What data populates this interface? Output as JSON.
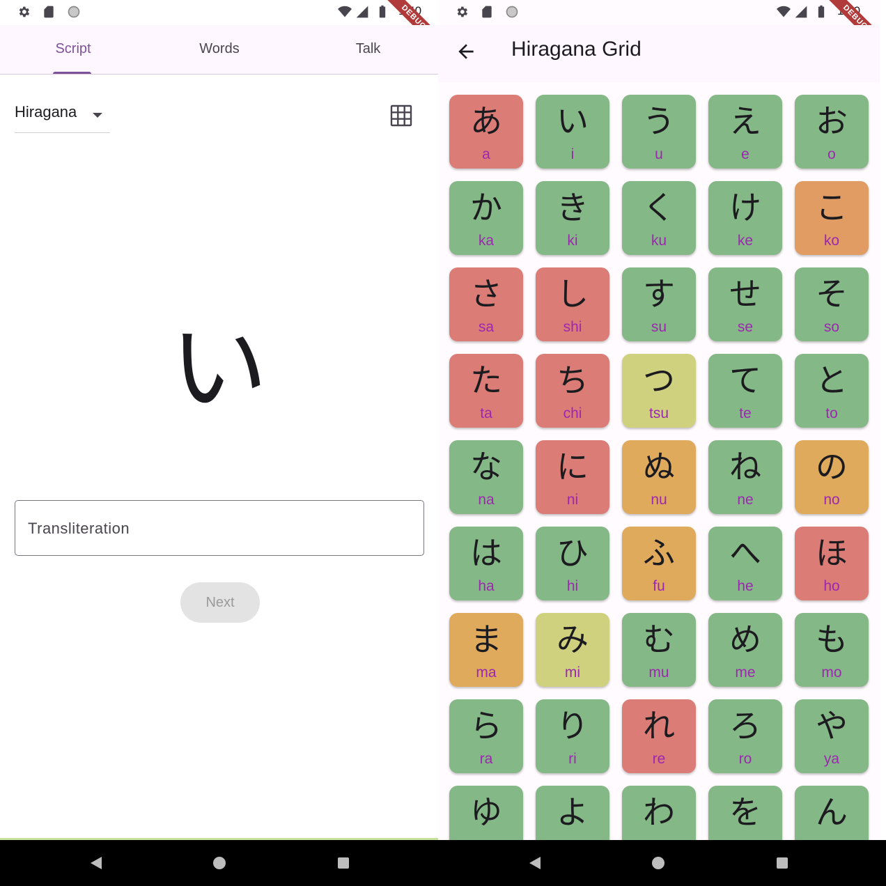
{
  "status_bar": {
    "time": "1:40"
  },
  "debug_banner": "DEBUG",
  "left": {
    "tabs": [
      "Script",
      "Words",
      "Talk"
    ],
    "active_tab": "Script",
    "script_dropdown": {
      "selected": "Hiragana"
    },
    "current_character": "い",
    "transliteration_input": {
      "placeholder": "Transliteration",
      "value": ""
    },
    "next_button": "Next"
  },
  "right": {
    "title": "Hiragana Grid",
    "colors": {
      "red": "#db7c76",
      "green": "#85b887",
      "orange": "#e09c63",
      "amber": "#e0aa5d",
      "yellow": "#cfd17f",
      "romaji": "#9c27b0",
      "accent": "#7d5296"
    },
    "grid": [
      {
        "kana": "あ",
        "romaji": "a",
        "status": "red"
      },
      {
        "kana": "い",
        "romaji": "i",
        "status": "green"
      },
      {
        "kana": "う",
        "romaji": "u",
        "status": "green"
      },
      {
        "kana": "え",
        "romaji": "e",
        "status": "green"
      },
      {
        "kana": "お",
        "romaji": "o",
        "status": "green"
      },
      {
        "kana": "か",
        "romaji": "ka",
        "status": "green"
      },
      {
        "kana": "き",
        "romaji": "ki",
        "status": "green"
      },
      {
        "kana": "く",
        "romaji": "ku",
        "status": "green"
      },
      {
        "kana": "け",
        "romaji": "ke",
        "status": "green"
      },
      {
        "kana": "こ",
        "romaji": "ko",
        "status": "orange"
      },
      {
        "kana": "さ",
        "romaji": "sa",
        "status": "red"
      },
      {
        "kana": "し",
        "romaji": "shi",
        "status": "red"
      },
      {
        "kana": "す",
        "romaji": "su",
        "status": "green"
      },
      {
        "kana": "せ",
        "romaji": "se",
        "status": "green"
      },
      {
        "kana": "そ",
        "romaji": "so",
        "status": "green"
      },
      {
        "kana": "た",
        "romaji": "ta",
        "status": "red"
      },
      {
        "kana": "ち",
        "romaji": "chi",
        "status": "red"
      },
      {
        "kana": "つ",
        "romaji": "tsu",
        "status": "yellow"
      },
      {
        "kana": "て",
        "romaji": "te",
        "status": "green"
      },
      {
        "kana": "と",
        "romaji": "to",
        "status": "green"
      },
      {
        "kana": "な",
        "romaji": "na",
        "status": "green"
      },
      {
        "kana": "に",
        "romaji": "ni",
        "status": "red"
      },
      {
        "kana": "ぬ",
        "romaji": "nu",
        "status": "amber"
      },
      {
        "kana": "ね",
        "romaji": "ne",
        "status": "green"
      },
      {
        "kana": "の",
        "romaji": "no",
        "status": "amber"
      },
      {
        "kana": "は",
        "romaji": "ha",
        "status": "green"
      },
      {
        "kana": "ひ",
        "romaji": "hi",
        "status": "green"
      },
      {
        "kana": "ふ",
        "romaji": "fu",
        "status": "amber"
      },
      {
        "kana": "へ",
        "romaji": "he",
        "status": "green"
      },
      {
        "kana": "ほ",
        "romaji": "ho",
        "status": "red"
      },
      {
        "kana": "ま",
        "romaji": "ma",
        "status": "amber"
      },
      {
        "kana": "み",
        "romaji": "mi",
        "status": "yellow"
      },
      {
        "kana": "む",
        "romaji": "mu",
        "status": "green"
      },
      {
        "kana": "め",
        "romaji": "me",
        "status": "green"
      },
      {
        "kana": "も",
        "romaji": "mo",
        "status": "green"
      },
      {
        "kana": "ら",
        "romaji": "ra",
        "status": "green"
      },
      {
        "kana": "り",
        "romaji": "ri",
        "status": "green"
      },
      {
        "kana": "れ",
        "romaji": "re",
        "status": "red"
      },
      {
        "kana": "ろ",
        "romaji": "ro",
        "status": "green"
      },
      {
        "kana": "や",
        "romaji": "ya",
        "status": "green"
      },
      {
        "kana": "ゆ",
        "romaji": "",
        "status": "green"
      },
      {
        "kana": "よ",
        "romaji": "",
        "status": "green"
      },
      {
        "kana": "わ",
        "romaji": "",
        "status": "green"
      },
      {
        "kana": "を",
        "romaji": "",
        "status": "green"
      },
      {
        "kana": "ん",
        "romaji": "",
        "status": "green"
      }
    ]
  }
}
